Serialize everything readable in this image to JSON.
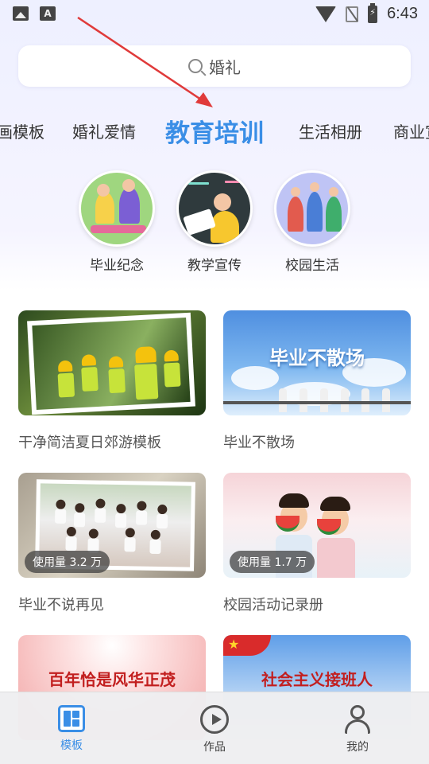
{
  "status_bar": {
    "time": "6:43",
    "icons": [
      "image-icon",
      "text-icon",
      "wifi-icon",
      "no-sim-icon",
      "battery-charging-icon"
    ]
  },
  "search": {
    "placeholder": "婚礼"
  },
  "category_tabs": [
    {
      "label": "画模板",
      "active": false
    },
    {
      "label": "婚礼爱情",
      "active": false
    },
    {
      "label": "教育培训",
      "active": true
    },
    {
      "label": "生活相册",
      "active": false
    },
    {
      "label": "商业宣",
      "active": false
    }
  ],
  "subcategories": [
    {
      "label": "毕业纪念",
      "icon": "graduation-icon"
    },
    {
      "label": "教学宣传",
      "icon": "teaching-icon"
    },
    {
      "label": "校园生活",
      "icon": "campus-life-icon"
    }
  ],
  "cards": [
    {
      "title": "干净简洁夏日郊游模板",
      "usage": null
    },
    {
      "title": "毕业不散场",
      "banner": "毕业不散场",
      "usage": null
    },
    {
      "title": "毕业不说再见",
      "usage": "使用量 3.2 万"
    },
    {
      "title": "校园活动记录册",
      "usage": "使用量 1.7 万"
    },
    {
      "title": "",
      "banner": "百年恰是风华正茂",
      "usage": null
    },
    {
      "title": "",
      "banner": "社会主义接班人",
      "usage": null
    }
  ],
  "bottom_nav": [
    {
      "label": "模板",
      "icon": "templates-icon",
      "active": true
    },
    {
      "label": "作品",
      "icon": "works-play-icon",
      "active": false
    },
    {
      "label": "我的",
      "icon": "profile-icon",
      "active": false
    }
  ],
  "colors": {
    "accent": "#3a8ee6",
    "annotation_arrow": "#e03a3a"
  }
}
